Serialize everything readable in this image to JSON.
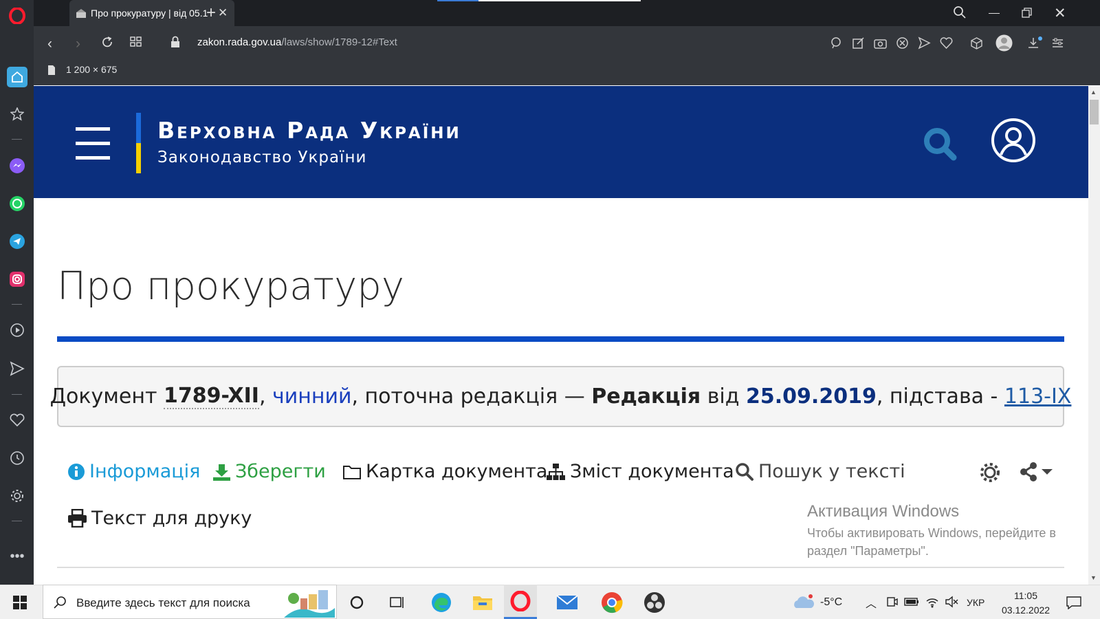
{
  "browser": {
    "tab_title": "Про прокуратуру | від 05.1",
    "url_host": "zakon.rada.gov.ua",
    "url_path": "/laws/show/1789-12#Text",
    "dimension_label": "1 200 × 675"
  },
  "site": {
    "title": "Верховна Рада України",
    "subtitle": "Законодавство України"
  },
  "page": {
    "title": "Про прокуратуру"
  },
  "doc_status": {
    "prefix": "Документ ",
    "number": "1789-XII",
    "sep1": ", ",
    "state": "чинний",
    "middle": ", поточна редакція — ",
    "edition_label": "Редакція",
    "from_label": " від ",
    "date": "25.09.2019",
    "basis_label": ", підстава - ",
    "basis": "113-IX"
  },
  "toolbar": {
    "info": "Інформація",
    "save": "Зберегти",
    "card": "Картка документа",
    "contents": "Зміст документа",
    "search": "Пошук у тексті",
    "print": "Текст для друку"
  },
  "watermark": {
    "title": "Активация Windows",
    "line1": "Чтобы активировать Windows, перейдите в",
    "line2": "раздел \"Параметры\"."
  },
  "taskbar": {
    "search_placeholder": "Введите здесь текст для поиска",
    "weather": "-5°C",
    "language": "УКР",
    "time": "11:05",
    "date": "03.12.2022"
  },
  "colors": {
    "header_bg": "#0b2f7e",
    "accent_blue": "#0a4bc4",
    "link_info": "#1a9bd7",
    "save_green": "#2ea043"
  }
}
